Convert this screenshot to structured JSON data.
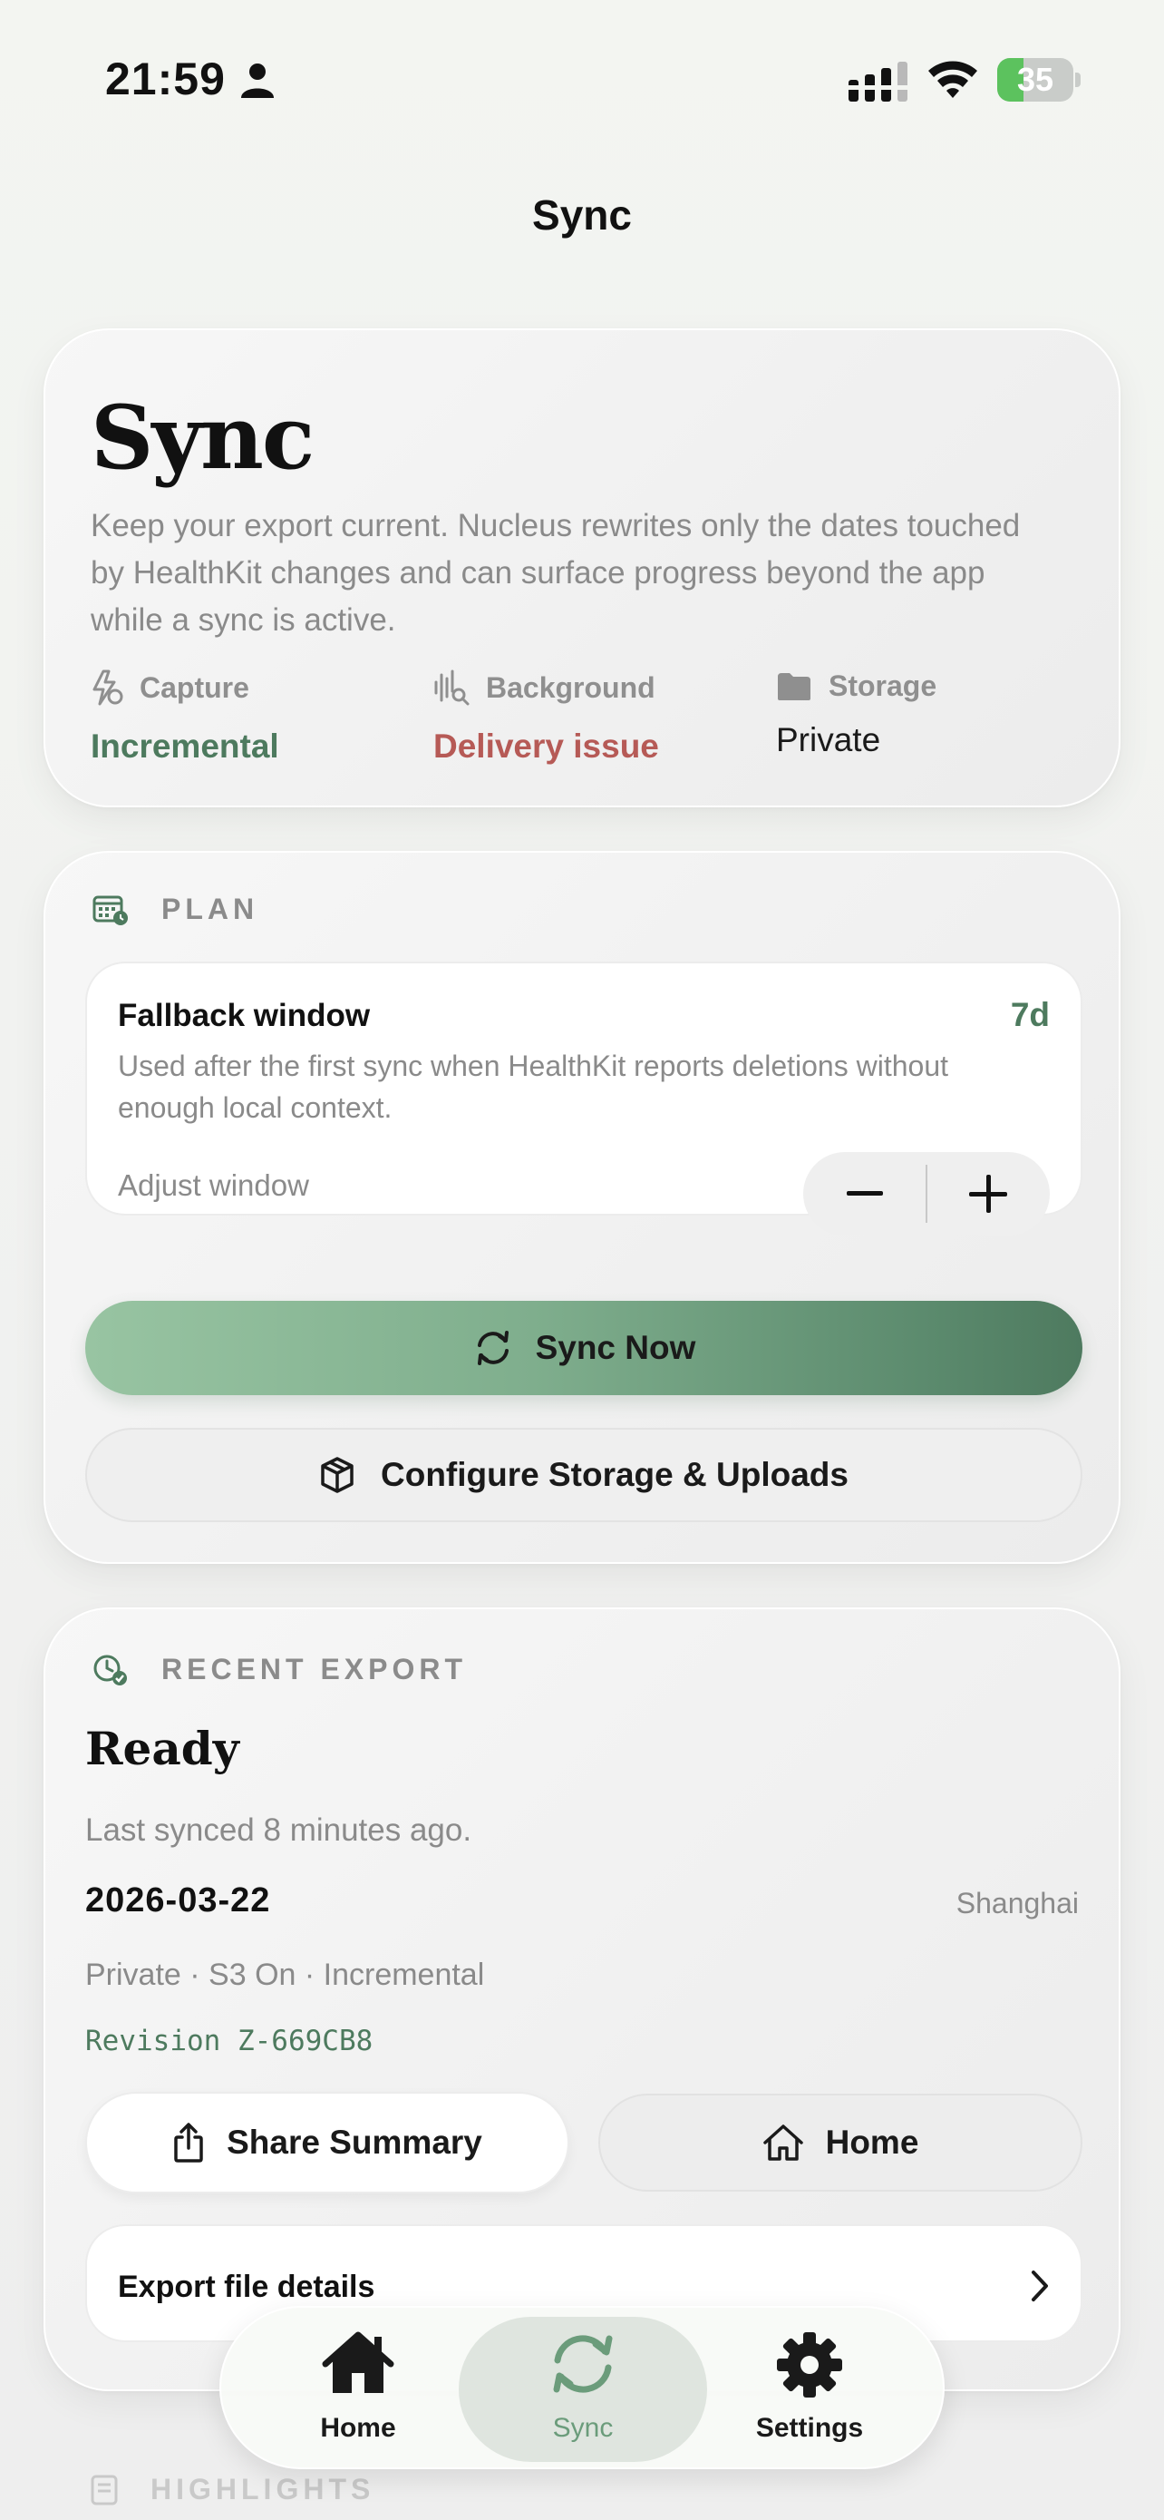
{
  "status_bar": {
    "time": "21:59",
    "battery": "35",
    "battery_level": 0.35
  },
  "nav": {
    "title": "Sync"
  },
  "hero": {
    "title": "Sync",
    "description": "Keep your export current. Nucleus rewrites only the dates touched by HealthKit changes and can surface progress beyond the app while a sync is active.",
    "metrics": [
      {
        "label": "Capture",
        "value": "Incremental",
        "icon": "bolt-clock-icon",
        "color": "#4d7a5e"
      },
      {
        "label": "Background",
        "value": "Delivery issue",
        "icon": "waveform-search-icon",
        "color": "#b65a56"
      },
      {
        "label": "Storage",
        "value": "Private",
        "icon": "folder-icon",
        "color": "#1a1a1a"
      }
    ]
  },
  "plan": {
    "header": "PLAN",
    "fallback": {
      "title": "Fallback window",
      "days": "7d",
      "description": "Used after the first sync when HealthKit reports deletions without enough local context.",
      "adjust_label": "Adjust window"
    },
    "sync_now": "Sync Now",
    "configure": "Configure Storage & Uploads"
  },
  "recent": {
    "header": "RECENT EXPORT",
    "status": "Ready",
    "last_synced": "Last synced 8 minutes ago.",
    "date": "2026-03-22",
    "city": "Shanghai",
    "meta": "Private · S3 On · Incremental",
    "revision": "Revision Z-669CB8",
    "share": "Share Summary",
    "home": "Home",
    "export_details": "Export file details"
  },
  "highlights": {
    "header": "HIGHLIGHTS"
  },
  "tabbar": {
    "home": "Home",
    "sync": "Sync",
    "settings": "Settings",
    "active": "sync"
  },
  "colors": {
    "accent": "#4d7a5e",
    "warning": "#b65a56",
    "active_tab": "#6b9c7b"
  }
}
